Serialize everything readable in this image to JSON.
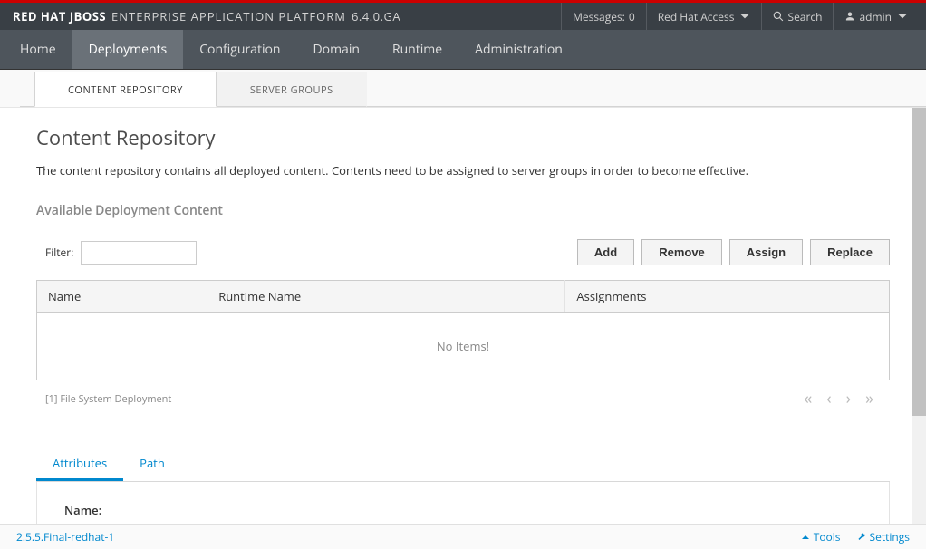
{
  "header": {
    "brand_redhat": "RED HAT",
    "brand_jboss": "JBOSS",
    "brand_eap": "ENTERPRISE APPLICATION PLATFORM",
    "brand_version": "6.4.0.GA",
    "messages_label": "Messages:",
    "messages_count": "0",
    "access_label": "Red Hat Access",
    "search_label": "Search",
    "user_label": "admin"
  },
  "nav": {
    "items": [
      {
        "label": "Home"
      },
      {
        "label": "Deployments"
      },
      {
        "label": "Configuration"
      },
      {
        "label": "Domain"
      },
      {
        "label": "Runtime"
      },
      {
        "label": "Administration"
      }
    ],
    "active_index": 1
  },
  "sub_tabs": {
    "items": [
      {
        "label": "CONTENT REPOSITORY"
      },
      {
        "label": "SERVER GROUPS"
      }
    ],
    "active_index": 0
  },
  "page": {
    "title": "Content Repository",
    "description": "The content repository contains all deployed content. Contents need to be assigned to server groups in order to become effective.",
    "section_subtitle": "Available Deployment Content",
    "filter_label": "Filter:",
    "filter_value": "",
    "buttons": {
      "add": "Add",
      "remove": "Remove",
      "assign": "Assign",
      "replace": "Replace"
    },
    "table": {
      "columns": [
        "Name",
        "Runtime Name",
        "Assignments"
      ],
      "rows": [],
      "empty_text": "No Items!"
    },
    "footer_note": "[1] File System Deployment",
    "detail_tabs": {
      "items": [
        {
          "label": "Attributes"
        },
        {
          "label": "Path"
        }
      ],
      "active_index": 0
    },
    "detail_fields": {
      "name_label": "Name:"
    }
  },
  "footer": {
    "version": "2.5.5.Final-redhat-1",
    "tools_label": "Tools",
    "settings_label": "Settings"
  }
}
